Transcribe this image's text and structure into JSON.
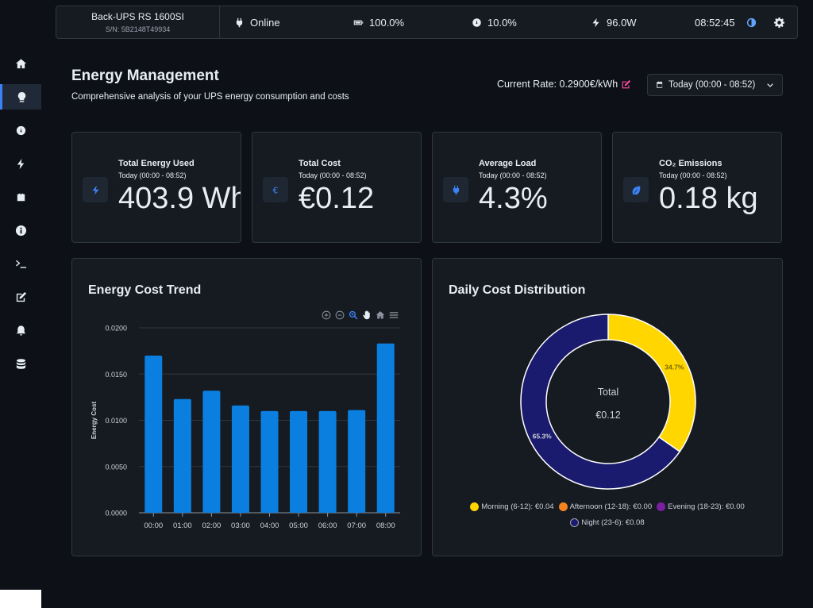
{
  "sidebar": {
    "items": [
      {
        "name": "home-icon"
      },
      {
        "name": "energy-bulb-icon",
        "active": true
      },
      {
        "name": "gauge-icon"
      },
      {
        "name": "power-bolt-icon"
      },
      {
        "name": "battery-icon"
      },
      {
        "name": "info-icon"
      },
      {
        "name": "terminal-icon"
      },
      {
        "name": "edit-icon"
      },
      {
        "name": "bell-icon"
      },
      {
        "name": "database-icon"
      }
    ]
  },
  "topbar": {
    "device_name": "Back-UPS RS 1600SI",
    "serial": "S/N: 5B2148T49934",
    "status": "Online",
    "battery": "100.0%",
    "load": "10.0%",
    "power": "96.0W",
    "time": "08:52:45"
  },
  "header": {
    "title": "Energy Management",
    "subtitle": "Comprehensive analysis of your UPS energy consumption and costs",
    "rate": "Current Rate: 0.2900€/kWh",
    "range": "Today (00:00 - 08:52)"
  },
  "cards": [
    {
      "title": "Total Energy Used",
      "subtitle": "Today (00:00 - 08:52)",
      "value": "403.9 Wh",
      "icon": "bolt-icon"
    },
    {
      "title": "Total Cost",
      "subtitle": "Today (00:00 - 08:52)",
      "value": "€0.12",
      "icon": "euro-icon"
    },
    {
      "title": "Average Load",
      "subtitle": "Today (00:00 - 08:52)",
      "value": "4.3%",
      "icon": "plug-icon"
    },
    {
      "title": "CO₂ Emissions",
      "subtitle": "Today (00:00 - 08:52)",
      "value": "0.18 kg",
      "icon": "leaf-icon"
    }
  ],
  "trend_panel": {
    "title": "Energy Cost Trend"
  },
  "distribution_panel": {
    "title": "Daily Cost Distribution",
    "center_label": "Total",
    "center_value": "€0.12"
  },
  "colors": {
    "bar": "#0a7fe0",
    "morning": "#ffd600",
    "afternoon": "#f5841f",
    "evening": "#7b1fa2",
    "night": "#1a1a6e",
    "accent": "#3b82f6",
    "edit": "#ec4899"
  },
  "chart_data": [
    {
      "type": "bar",
      "title": "Energy Cost Trend",
      "xlabel": "",
      "ylabel": "Energy Cost",
      "ylim": [
        0,
        0.02
      ],
      "yticks": [
        "0.0200",
        "0.0150",
        "0.0100",
        "0.0050",
        "0.0000"
      ],
      "categories": [
        "00:00",
        "01:00",
        "02:00",
        "03:00",
        "04:00",
        "05:00",
        "06:00",
        "07:00",
        "08:00"
      ],
      "values": [
        0.017,
        0.0123,
        0.0132,
        0.0116,
        0.011,
        0.011,
        0.011,
        0.0111,
        0.0183
      ],
      "grid": true
    },
    {
      "type": "pie",
      "title": "Daily Cost Distribution",
      "labels": [
        "Morning (6-12): €0.04",
        "Afternoon (12-18): €0.00",
        "Evening (18-23): €0.00",
        "Night (23-6): €0.08"
      ],
      "values": [
        34.7,
        0,
        0,
        65.3
      ],
      "slice_labels": [
        "34.7%",
        "",
        "",
        "65.3%"
      ],
      "legend": "bottom"
    }
  ]
}
